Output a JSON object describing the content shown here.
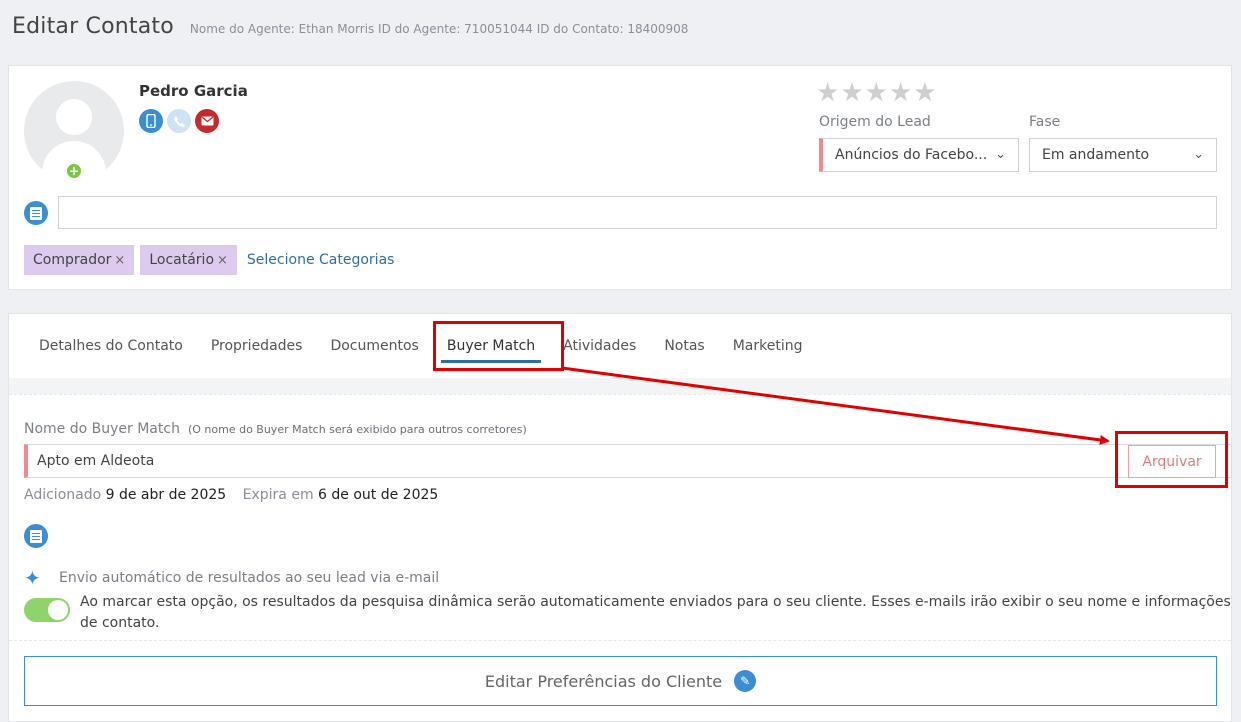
{
  "header": {
    "title": "Editar Contato",
    "meta": "Nome do Agente: Ethan Morris ID do Agente: 710051044 ID do Contato: 18400908"
  },
  "contact": {
    "name": "Pedro Garcia",
    "lead_origin_label": "Origem do Lead",
    "lead_origin_value": "Anúncios do Facebo...",
    "phase_label": "Fase",
    "phase_value": "Em andamento",
    "rating": 0,
    "tags": [
      {
        "label": "Comprador"
      },
      {
        "label": "Locatário"
      }
    ],
    "tag_remove_glyph": "×",
    "select_categories": "Selecione Categorias"
  },
  "tabs": [
    {
      "label": "Detalhes do Contato"
    },
    {
      "label": "Propriedades"
    },
    {
      "label": "Documentos"
    },
    {
      "label": "Buyer Match"
    },
    {
      "label": "Atividades"
    },
    {
      "label": "Notas"
    },
    {
      "label": "Marketing"
    }
  ],
  "buyer_match": {
    "name_label": "Nome do Buyer Match",
    "name_hint": "(O nome do Buyer Match será exibido para outros corretores)",
    "name_value": "Apto em Aldeota",
    "archive_button": "Arquivar",
    "added_label": "Adicionado",
    "added_value": "9 de abr de 2025",
    "expires_label": "Expira em",
    "expires_value": "6 de out de 2025",
    "auto_send_title": "Envio automático de resultados ao seu lead via e-mail",
    "auto_send_desc": "Ao marcar esta opção, os resultados da pesquisa dinâmica serão automaticamente enviados para o seu cliente. Esses e-mails irão exibir o seu nome e informações de contato.",
    "auto_send_enabled": true,
    "edit_preferences_button": "Editar Preferências do Cliente"
  },
  "colors": {
    "accent": "#3b8fd0",
    "highlight": "#e00000",
    "tag_bg": "#dccbef",
    "required": "#f08a8f",
    "toggle_on": "#8fd36b"
  }
}
